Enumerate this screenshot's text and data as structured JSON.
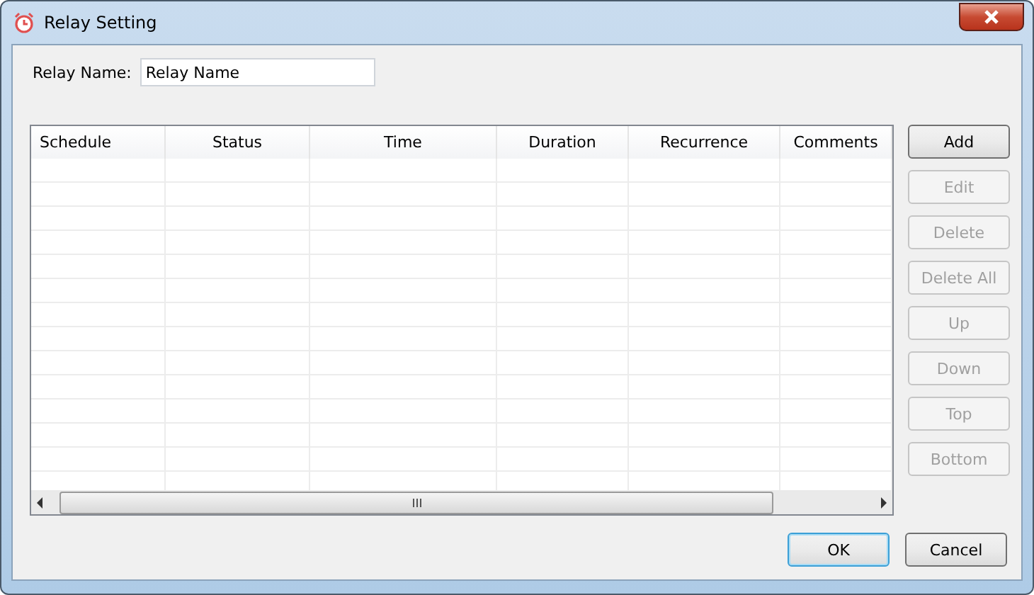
{
  "window": {
    "title": "Relay Setting"
  },
  "relay_name": {
    "label": "Relay Name:",
    "value": "Relay Name"
  },
  "table": {
    "columns": [
      "Schedule",
      "Status",
      "Time",
      "Duration",
      "Recurrence",
      "Comments"
    ]
  },
  "side_buttons": [
    {
      "label": "Add",
      "disabled": false
    },
    {
      "label": "Edit",
      "disabled": true
    },
    {
      "label": "Delete",
      "disabled": true
    },
    {
      "label": "Delete All",
      "disabled": true
    },
    {
      "label": "Up",
      "disabled": true
    },
    {
      "label": "Down",
      "disabled": true
    },
    {
      "label": "Top",
      "disabled": true
    },
    {
      "label": "Bottom",
      "disabled": true
    }
  ],
  "dialog_buttons": [
    {
      "label": "OK",
      "focused": true
    },
    {
      "label": "Cancel",
      "focused": false
    }
  ]
}
